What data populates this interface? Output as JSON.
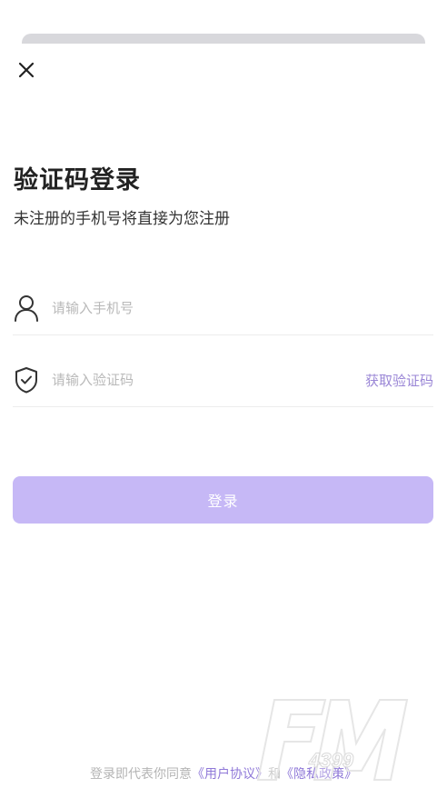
{
  "header": {
    "close_icon": "close-icon"
  },
  "title": "验证码登录",
  "subtitle": "未注册的手机号将直接为您注册",
  "phone_field": {
    "icon": "user-icon",
    "placeholder": "请输入手机号",
    "value": ""
  },
  "code_field": {
    "icon": "shield-check-icon",
    "placeholder": "请输入验证码",
    "value": "",
    "get_code_label": "获取验证码"
  },
  "login_button": {
    "label": "登录"
  },
  "agreement": {
    "prefix": "登录即代表你同意",
    "user_agreement": "《用户协议》",
    "conjunction": "和",
    "privacy_policy": "《隐私政策》"
  },
  "watermark": {
    "letters": "FM",
    "number": "4399"
  },
  "colors": {
    "accent": "#9a86d6",
    "button": "#c6b8f6",
    "placeholder": "#b9b9b9",
    "divider": "#ececec"
  }
}
